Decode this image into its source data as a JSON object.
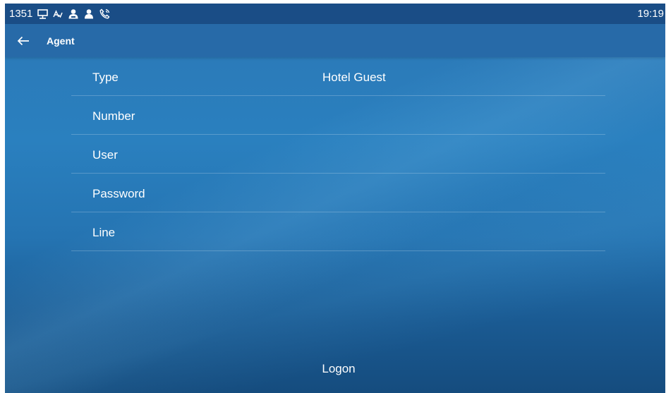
{
  "status_bar": {
    "extension": "1351",
    "time": "19:19",
    "icons": [
      "network-icon",
      "autoanswer-icon",
      "contacts-icon",
      "user-icon",
      "call-forward-icon"
    ]
  },
  "app_bar": {
    "back_icon": "arrow-left-icon",
    "title": "Agent"
  },
  "form": {
    "rows": [
      {
        "label": "Type",
        "value": "Hotel Guest"
      },
      {
        "label": "Number",
        "value": ""
      },
      {
        "label": "User",
        "value": ""
      },
      {
        "label": "Password",
        "value": ""
      },
      {
        "label": "Line",
        "value": ""
      }
    ]
  },
  "actions": {
    "logon_label": "Logon"
  },
  "colors": {
    "status_bar": "#1a4d86",
    "app_bar": "#276aa8",
    "background": "#2a80bf",
    "text": "#ffffff"
  }
}
